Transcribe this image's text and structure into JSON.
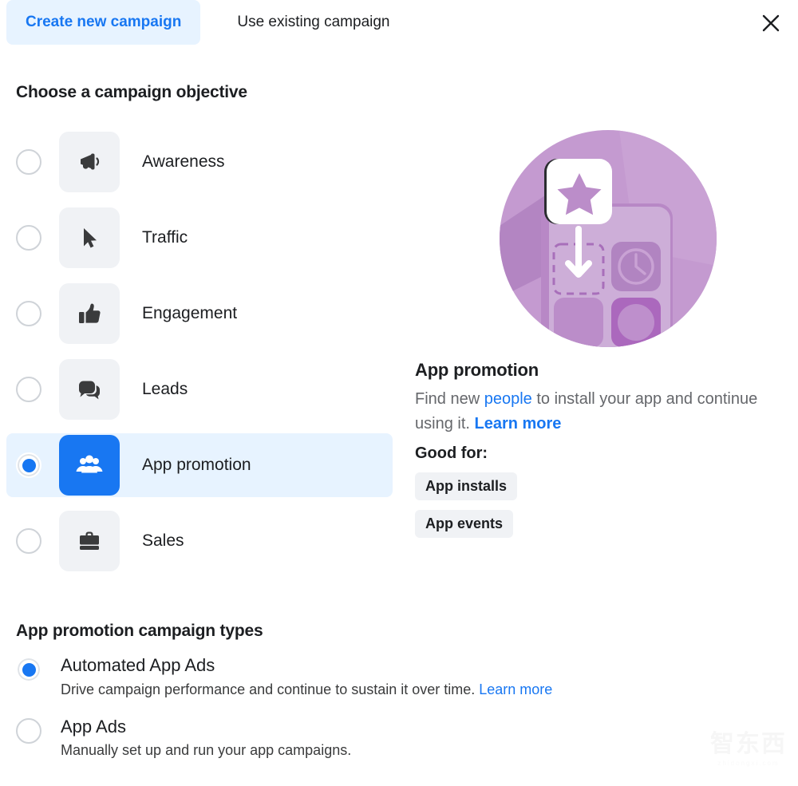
{
  "tabs": [
    {
      "label": "Create new campaign",
      "active": true,
      "name": "tab-create-new-campaign"
    },
    {
      "label": "Use existing campaign",
      "active": false,
      "name": "tab-use-existing-campaign"
    }
  ],
  "close_label": "Close",
  "objective_section": {
    "title": "Choose a campaign objective",
    "items": [
      {
        "label": "Awareness",
        "icon": "megaphone-icon",
        "selected": false
      },
      {
        "label": "Traffic",
        "icon": "cursor-icon",
        "selected": false
      },
      {
        "label": "Engagement",
        "icon": "thumbs-up-icon",
        "selected": false
      },
      {
        "label": "Leads",
        "icon": "chat-bubbles-icon",
        "selected": false
      },
      {
        "label": "App promotion",
        "icon": "people-group-icon",
        "selected": true
      },
      {
        "label": "Sales",
        "icon": "briefcase-icon",
        "selected": false
      }
    ]
  },
  "detail": {
    "illustration": "app-promotion-illustration",
    "title": "App promotion",
    "desc_part1": "Find new ",
    "desc_link1": "people",
    "desc_part2": " to install your app and continue using it. ",
    "desc_link2": "Learn more",
    "good_for_title": "Good for:",
    "chips": [
      "App installs",
      "App events"
    ]
  },
  "types_section": {
    "title": "App promotion campaign types",
    "items": [
      {
        "label": "Automated App Ads",
        "desc": "Drive campaign performance and continue to sustain it over time. ",
        "link": "Learn more",
        "selected": true
      },
      {
        "label": "App Ads",
        "desc": "Manually set up and run your app campaigns.",
        "link": "",
        "selected": false
      }
    ]
  },
  "watermark": {
    "cn": "智东西",
    "en": "zhidongxi.com"
  },
  "colors": {
    "accent_blue": "#1877f2",
    "selected_row_bg": "#e7f3ff",
    "tile_gray": "#f0f2f5",
    "text_primary": "#1c1e21",
    "text_secondary": "#65676b",
    "illustration_purple": "#bc91c9"
  }
}
